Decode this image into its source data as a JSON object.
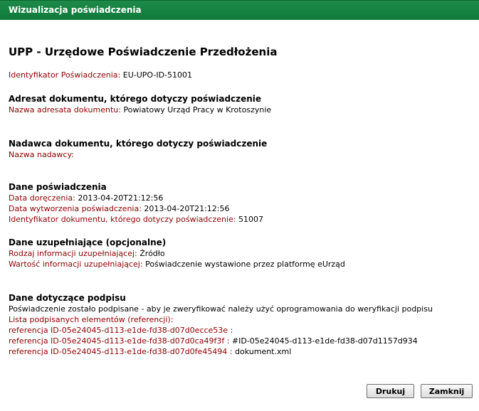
{
  "window": {
    "title": "Wizualizacja poświadczenia"
  },
  "main_title": "UPP - Urzędowe Poświadczenie Przedłożenia",
  "identifier": {
    "label": "Identyfikator Poświadczenia:",
    "value": "EU-UPO-ID-51001"
  },
  "recipient": {
    "title": "Adresat dokumentu, którego dotyczy poświadczenie",
    "name_label": "Nazwa adresata dokumentu:",
    "name_value": "Powiatowy Urząd Pracy w Krotoszynie"
  },
  "sender": {
    "title": "Nadawca dokumentu, którego dotyczy poświadczenie",
    "name_label": "Nazwa nadawcy:",
    "name_value": ""
  },
  "certificate": {
    "title": "Dane poświadczenia",
    "delivery_label": "Data doręczenia:",
    "delivery_value": "2013-04-20T21:12:56",
    "created_label": "Data wytworzenia poświadczenia:",
    "created_value": "2013-04-20T21:12:56",
    "docid_label": "Identyfikator dokumentu, którego dotyczy poświadczenie:",
    "docid_value": "51007"
  },
  "supplementary": {
    "title": "Dane uzupełniające (opcjonalne)",
    "type_label": "Rodzaj informacji uzupełniającej:",
    "type_value": "Źródło",
    "value_label": "Wartość informacji uzupełniającej:",
    "value_value": "Poświadczenie wystawione przez platformę eUrząd"
  },
  "signature": {
    "title": "Dane dotyczące podpisu",
    "note": "Poświadczenie zostało podpisane - aby je zweryfikować należy użyć oprogramowania do weryfikacji podpisu",
    "list_label": "Lista podpisanych elementów (referencji):",
    "refs": [
      {
        "label": "referencja ID-05e24045-d113-e1de-fd38-d07d0ecce53e :",
        "value": ""
      },
      {
        "label": "referencja ID-05e24045-d113-e1de-fd38-d07d0ca49f3f :",
        "value": "#ID-05e24045-d113-e1de-fd38-d07d1157d934"
      },
      {
        "label": "referencja ID-05e24045-d113-e1de-fd38-d07d0fe45494 :",
        "value": "dokument.xml"
      }
    ]
  },
  "buttons": {
    "print": "Drukuj",
    "close": "Zamknij"
  }
}
